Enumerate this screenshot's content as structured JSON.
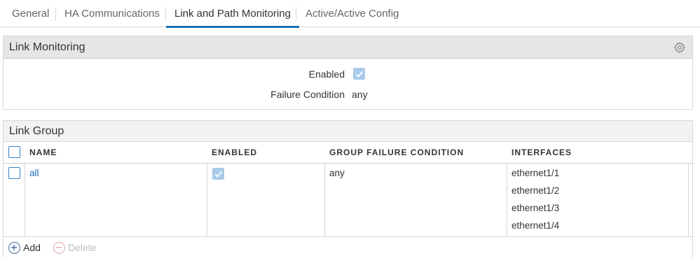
{
  "tabs": [
    {
      "label": "General",
      "active": false
    },
    {
      "label": "HA Communications",
      "active": false
    },
    {
      "label": "Link and Path Monitoring",
      "active": true
    },
    {
      "label": "Active/Active Config",
      "active": false
    }
  ],
  "link_monitoring": {
    "title": "Link Monitoring",
    "enabled_label": "Enabled",
    "enabled": true,
    "failure_condition_label": "Failure Condition",
    "failure_condition_value": "any",
    "settings_icon": "gear-icon"
  },
  "link_group": {
    "title": "Link Group",
    "columns": [
      "NAME",
      "ENABLED",
      "GROUP FAILURE CONDITION",
      "INTERFACES"
    ],
    "rows": [
      {
        "name": "all",
        "enabled": true,
        "group_failure_condition": "any",
        "interfaces": [
          "ethernet1/1",
          "ethernet1/2",
          "ethernet1/3",
          "ethernet1/4"
        ]
      }
    ],
    "toolbar": {
      "add_label": "Add",
      "delete_label": "Delete"
    }
  },
  "colors": {
    "accent": "#1a6fb8",
    "checkbox_disabled": "#a9cbe9",
    "header_bg": "#e6e6e6"
  }
}
